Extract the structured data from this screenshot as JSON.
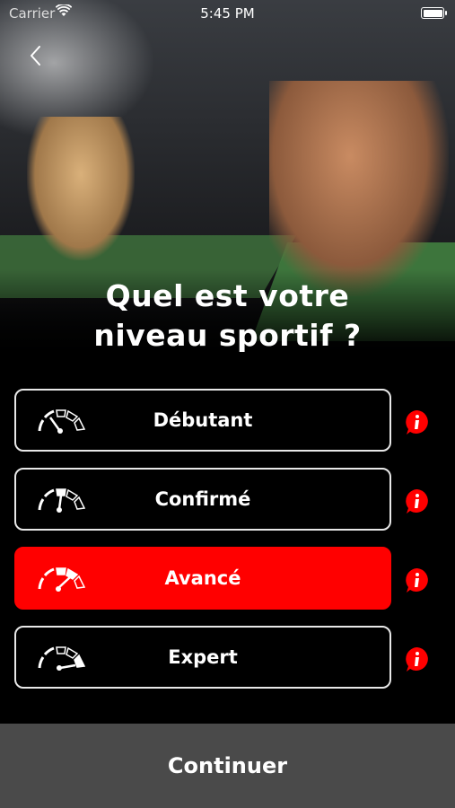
{
  "status_bar": {
    "carrier": "Carrier",
    "time": "5:45 PM"
  },
  "page": {
    "title_line1": "Quel est votre",
    "title_line2": "niveau sportif ?"
  },
  "levels": [
    {
      "label": "Débutant",
      "selected": false
    },
    {
      "label": "Confirmé",
      "selected": false
    },
    {
      "label": "Avancé",
      "selected": true
    },
    {
      "label": "Expert",
      "selected": false
    }
  ],
  "actions": {
    "continue_label": "Continuer"
  },
  "colors": {
    "accent": "#ff0000",
    "background": "#000000",
    "continue_bg": "#4a4a4a"
  }
}
